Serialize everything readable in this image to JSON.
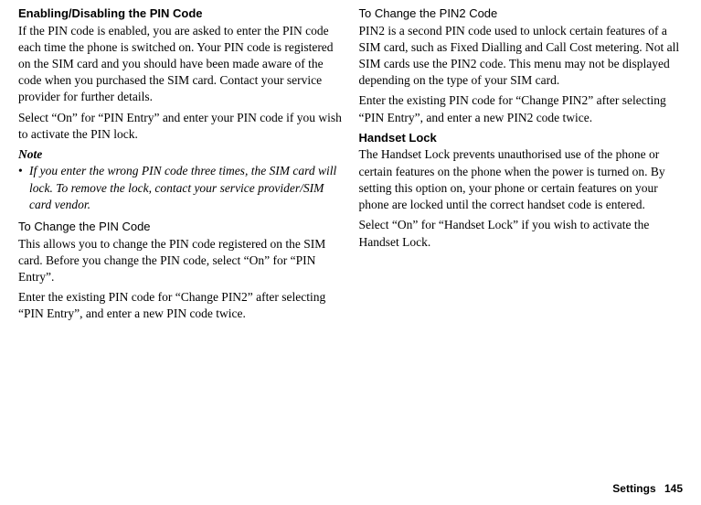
{
  "left": {
    "h1": "Enabling/Disabling the PIN Code",
    "p1": "If the PIN code is enabled, you are asked to enter the PIN code each time the phone is switched on. Your PIN code is registered on the SIM card and you should have been made aware of the code when you purchased the SIM card. Contact your service provider for further details.",
    "p2": "Select “On” for “PIN Entry” and enter your PIN code if you wish to activate the PIN lock.",
    "note_label": "Note",
    "note_item": "If you enter the wrong PIN code three times, the SIM card will lock. To remove the lock, contact your service provider/SIM card vendor.",
    "h2": "To Change the PIN Code",
    "p3": "This allows you to change the PIN code registered on the SIM card. Before you change the PIN code, select “On” for “PIN Entry”.",
    "p4": "Enter the existing PIN code for “Change PIN2” after selecting “PIN Entry”, and enter a new PIN code twice."
  },
  "right": {
    "h1": "To Change the PIN2 Code",
    "p1": "PIN2 is a second PIN code used to unlock certain features of a SIM card, such as Fixed Dialling and Call Cost metering. Not all SIM cards use the PIN2 code. This menu may not be displayed depending on the type of your SIM card.",
    "p2": "Enter the existing PIN code for “Change PIN2” after selecting “PIN Entry”, and enter a new PIN2 code twice.",
    "h2": "Handset Lock",
    "p3": "The Handset Lock prevents unauthorised use of the phone or certain features on the phone when the power is turned on. By setting this option on, your phone or certain features on your phone are locked until the correct handset code is entered.",
    "p4": "Select “On” for “Handset Lock” if you wish to activate the Handset Lock."
  },
  "footer": {
    "section": "Settings",
    "page": "145"
  }
}
